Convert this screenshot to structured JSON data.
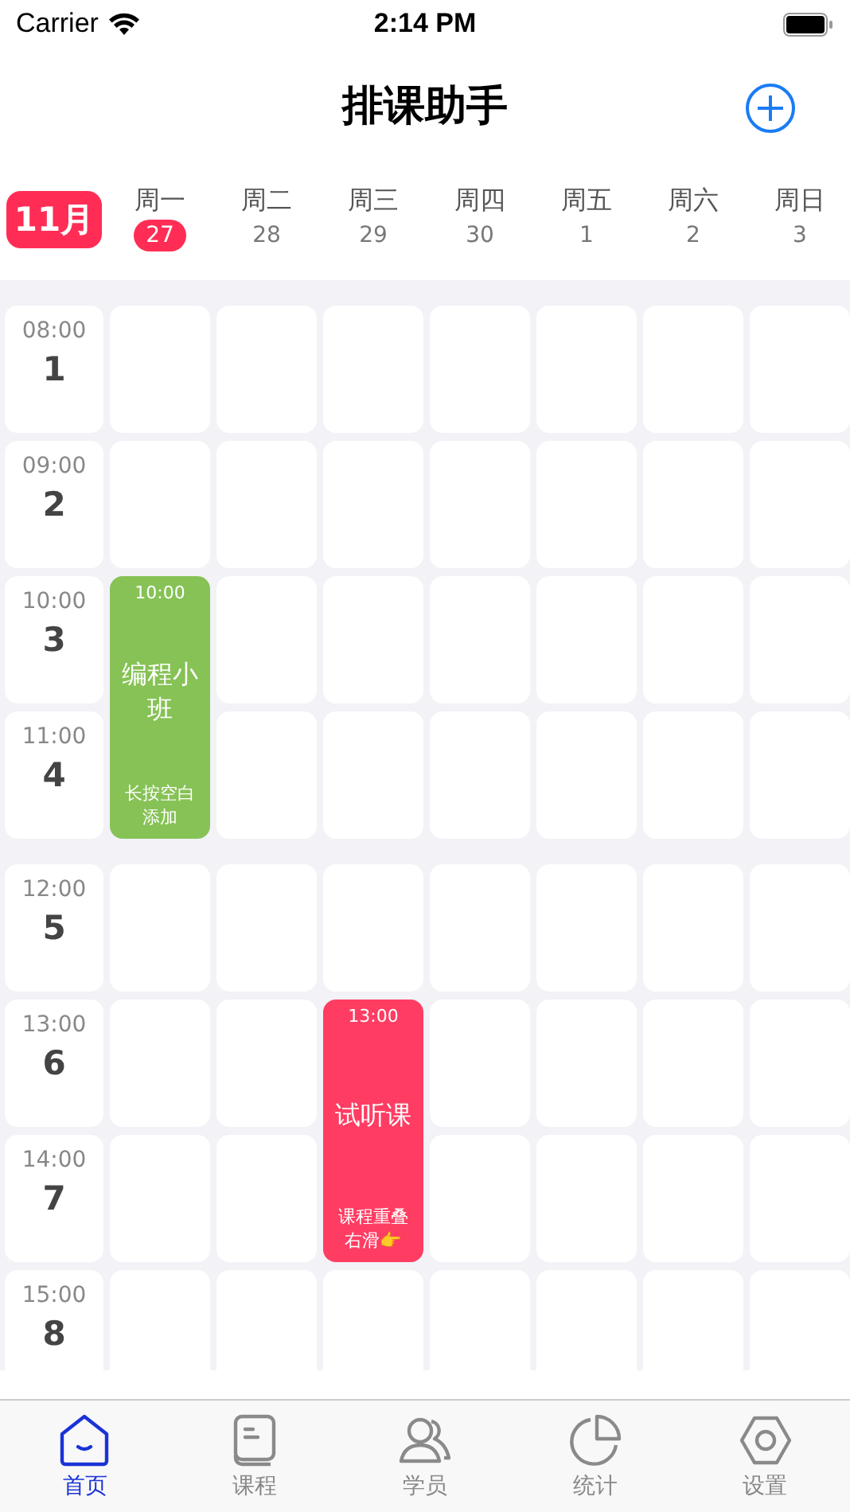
{
  "status_bar": {
    "carrier": "Carrier",
    "time": "2:14 PM"
  },
  "header": {
    "title": "排课助手"
  },
  "week": {
    "month": "11月",
    "days": [
      {
        "weekday": "周一",
        "date": "27",
        "selected": true
      },
      {
        "weekday": "周二",
        "date": "28",
        "selected": false
      },
      {
        "weekday": "周三",
        "date": "29",
        "selected": false
      },
      {
        "weekday": "周四",
        "date": "30",
        "selected": false
      },
      {
        "weekday": "周五",
        "date": "1",
        "selected": false
      },
      {
        "weekday": "周六",
        "date": "2",
        "selected": false
      },
      {
        "weekday": "周日",
        "date": "3",
        "selected": false
      }
    ]
  },
  "schedule": {
    "slots": [
      {
        "time": "08:00",
        "number": "1"
      },
      {
        "time": "09:00",
        "number": "2"
      },
      {
        "time": "10:00",
        "number": "3"
      },
      {
        "time": "11:00",
        "number": "4"
      },
      {
        "time": "12:00",
        "number": "5"
      },
      {
        "time": "13:00",
        "number": "6"
      },
      {
        "time": "14:00",
        "number": "7"
      },
      {
        "time": "15:00",
        "number": "8"
      }
    ],
    "events": [
      {
        "time": "10:00",
        "title": "编程小班",
        "note": "长按空白添加",
        "color": "#86c255"
      },
      {
        "time": "13:00",
        "title": "试听课",
        "note": "课程重叠右滑👉",
        "color": "#ff3d63"
      }
    ]
  },
  "tab_bar": [
    {
      "label": "首页",
      "selected": true
    },
    {
      "label": "课程",
      "selected": false
    },
    {
      "label": "学员",
      "selected": false
    },
    {
      "label": "统计",
      "selected": false
    },
    {
      "label": "设置",
      "selected": false
    }
  ]
}
